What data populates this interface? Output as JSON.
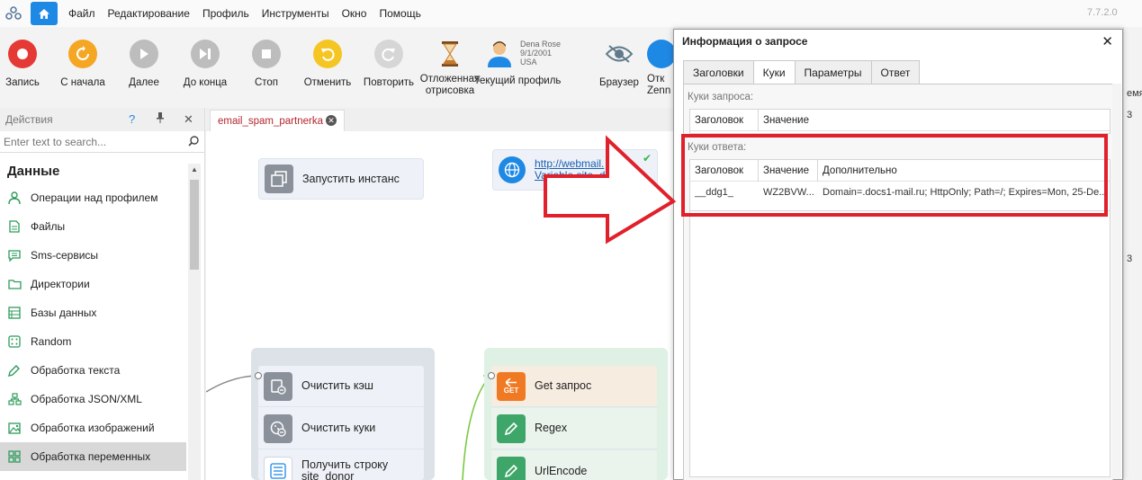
{
  "menubar": {
    "items": [
      "Файл",
      "Редактирование",
      "Профиль",
      "Инструменты",
      "Окно",
      "Помощь"
    ],
    "version": "7.7.2.0"
  },
  "toolbar": {
    "buttons": [
      {
        "label": "Запись",
        "icon": "record-icon",
        "color": "#e53935"
      },
      {
        "label": "С начала",
        "icon": "restart-icon",
        "color": "#f5a623"
      },
      {
        "label": "Далее",
        "icon": "play-icon",
        "color": "#bdbdbd"
      },
      {
        "label": "До конца",
        "icon": "skip-end-icon",
        "color": "#bdbdbd"
      },
      {
        "label": "Стоп",
        "icon": "stop-icon",
        "color": "#bdbdbd"
      },
      {
        "label": "Отменить",
        "icon": "undo-icon",
        "color": "#f5c623"
      },
      {
        "label": "Повторить",
        "icon": "redo-icon",
        "color": "#d6d6d6"
      },
      {
        "label": "Отложенная отрисовка",
        "icon": "hourglass-icon",
        "color": "#c47a2c"
      },
      {
        "label": "Текущий профиль",
        "icon": "user-icon",
        "color": "#1e88e5"
      },
      {
        "label": "Браузер",
        "icon": "eye-slash-icon",
        "color": "#5f7b8c"
      },
      {
        "label": "Отк Zenn",
        "icon": "zenno-icon",
        "color": "#1e88e5"
      }
    ],
    "profile": {
      "name": "Dena Rose",
      "date": "9/1/2001",
      "country": "USA"
    }
  },
  "left_panel": {
    "title": "Действия",
    "help": "?",
    "pin": "📌",
    "close": "✕",
    "search_placeholder": "Enter text to search...",
    "section": "Данные",
    "items": [
      {
        "label": "Операции над профилем",
        "icon": "profile-ops-icon"
      },
      {
        "label": "Файлы",
        "icon": "file-icon"
      },
      {
        "label": "Sms-сервисы",
        "icon": "sms-icon"
      },
      {
        "label": "Директории",
        "icon": "folder-icon"
      },
      {
        "label": "Базы данных",
        "icon": "database-icon"
      },
      {
        "label": "Random",
        "icon": "dice-icon"
      },
      {
        "label": "Обработка текста",
        "icon": "pencil-icon"
      },
      {
        "label": "Обработка JSON/XML",
        "icon": "tree-icon"
      },
      {
        "label": "Обработка изображений",
        "icon": "image-icon"
      },
      {
        "label": "Обработка переменных",
        "icon": "grid-icon",
        "selected": true
      }
    ]
  },
  "canvas": {
    "tab_label": "email_spam_partnerka",
    "nodes": {
      "launch": "Запустить инстанс",
      "url_line1": "http://webmail.",
      "url_line2": "Variable site_donor-/?=",
      "group1": [
        "Очистить кэш",
        "Очистить куки",
        "Получить строку site_donor"
      ],
      "group2": [
        "Get запрос",
        "Regex",
        "UrlEncode"
      ],
      "get_badge": "GET"
    }
  },
  "dialog": {
    "title": "Информация о запросе",
    "tabs": [
      "Заголовки",
      "Куки",
      "Параметры",
      "Ответ"
    ],
    "active_tab": "Куки",
    "request_cookies_label": "Куки запроса:",
    "request_columns": [
      "Заголовок",
      "Значение"
    ],
    "response_cookies_label": "Куки ответа:",
    "response_columns": [
      "Заголовок",
      "Значение",
      "Дополнительно"
    ],
    "response_rows": [
      {
        "header": "__ddg1_",
        "value": "WZ2BVW...",
        "extra": "Domain=.docs1-mail.ru; HttpOnly; Path=/; Expires=Mon, 25-De..."
      }
    ]
  },
  "right_peek": {
    "line1": "емя (",
    "line2": "3",
    "line3": "3"
  },
  "colors": {
    "accent": "#1e88e5",
    "annotation_red": "#e0202a",
    "selected_item": "#d8d8d8"
  }
}
